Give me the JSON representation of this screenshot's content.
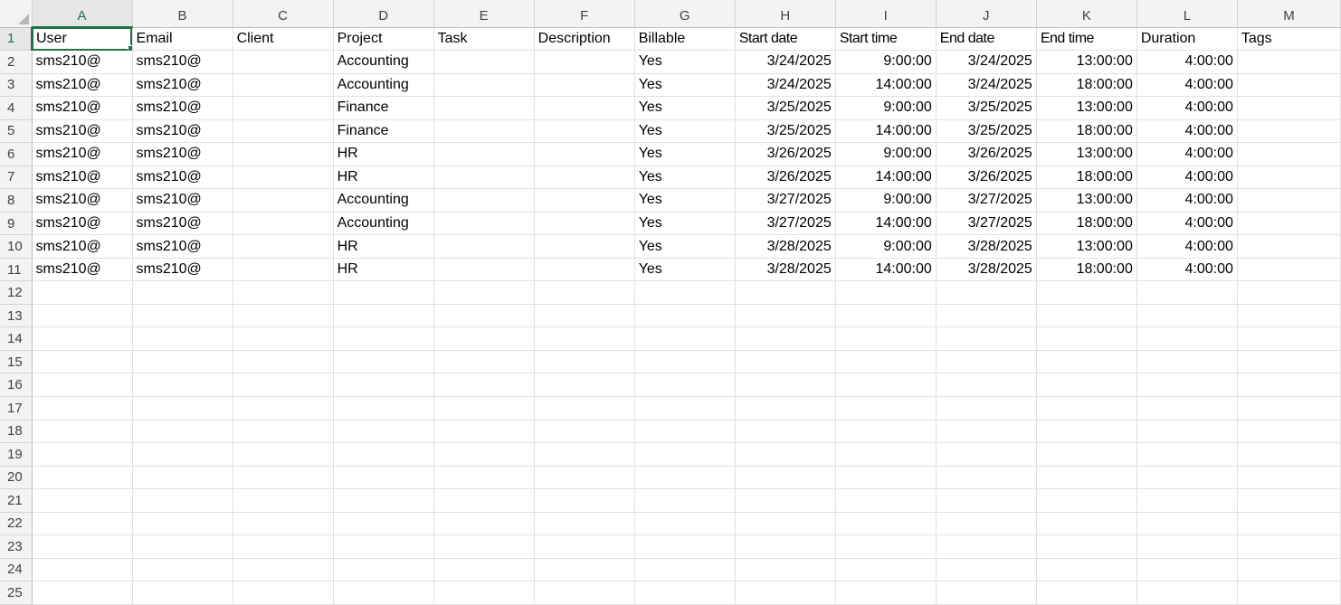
{
  "sheet": {
    "columns": [
      "A",
      "B",
      "C",
      "D",
      "E",
      "F",
      "G",
      "H",
      "I",
      "J",
      "K",
      "L",
      "M"
    ],
    "active_column": "A",
    "active_row": 1,
    "selected_cell": "A1",
    "row_numbers": [
      1,
      2,
      3,
      4,
      5,
      6,
      7,
      8,
      9,
      10,
      11,
      12,
      13,
      14,
      15,
      16,
      17,
      18,
      19,
      20,
      21,
      22,
      23,
      24,
      25
    ],
    "headers": [
      "User",
      "Email",
      "Client",
      "Project",
      "Task",
      "Description",
      "Billable",
      "Start date",
      "Start time",
      "End date",
      "End time",
      "Duration",
      "Tags"
    ],
    "rows": [
      [
        "sms210@",
        "sms210@",
        "",
        "Accounting",
        "",
        "",
        "Yes",
        "3/24/2025",
        "9:00:00",
        "3/24/2025",
        "13:00:00",
        "4:00:00",
        ""
      ],
      [
        "sms210@",
        "sms210@",
        "",
        "Accounting",
        "",
        "",
        "Yes",
        "3/24/2025",
        "14:00:00",
        "3/24/2025",
        "18:00:00",
        "4:00:00",
        ""
      ],
      [
        "sms210@",
        "sms210@",
        "",
        "Finance",
        "",
        "",
        "Yes",
        "3/25/2025",
        "9:00:00",
        "3/25/2025",
        "13:00:00",
        "4:00:00",
        ""
      ],
      [
        "sms210@",
        "sms210@",
        "",
        "Finance",
        "",
        "",
        "Yes",
        "3/25/2025",
        "14:00:00",
        "3/25/2025",
        "18:00:00",
        "4:00:00",
        ""
      ],
      [
        "sms210@",
        "sms210@",
        "",
        "HR",
        "",
        "",
        "Yes",
        "3/26/2025",
        "9:00:00",
        "3/26/2025",
        "13:00:00",
        "4:00:00",
        ""
      ],
      [
        "sms210@",
        "sms210@",
        "",
        "HR",
        "",
        "",
        "Yes",
        "3/26/2025",
        "14:00:00",
        "3/26/2025",
        "18:00:00",
        "4:00:00",
        ""
      ],
      [
        "sms210@",
        "sms210@",
        "",
        "Accounting",
        "",
        "",
        "Yes",
        "3/27/2025",
        "9:00:00",
        "3/27/2025",
        "13:00:00",
        "4:00:00",
        ""
      ],
      [
        "sms210@",
        "sms210@",
        "",
        "Accounting",
        "",
        "",
        "Yes",
        "3/27/2025",
        "14:00:00",
        "3/27/2025",
        "18:00:00",
        "4:00:00",
        ""
      ],
      [
        "sms210@",
        "sms210@",
        "",
        "HR",
        "",
        "",
        "Yes",
        "3/28/2025",
        "9:00:00",
        "3/28/2025",
        "13:00:00",
        "4:00:00",
        ""
      ],
      [
        "sms210@",
        "sms210@",
        "",
        "HR",
        "",
        "",
        "Yes",
        "3/28/2025",
        "14:00:00",
        "3/28/2025",
        "18:00:00",
        "4:00:00",
        ""
      ]
    ],
    "accent_color": "#217346"
  }
}
